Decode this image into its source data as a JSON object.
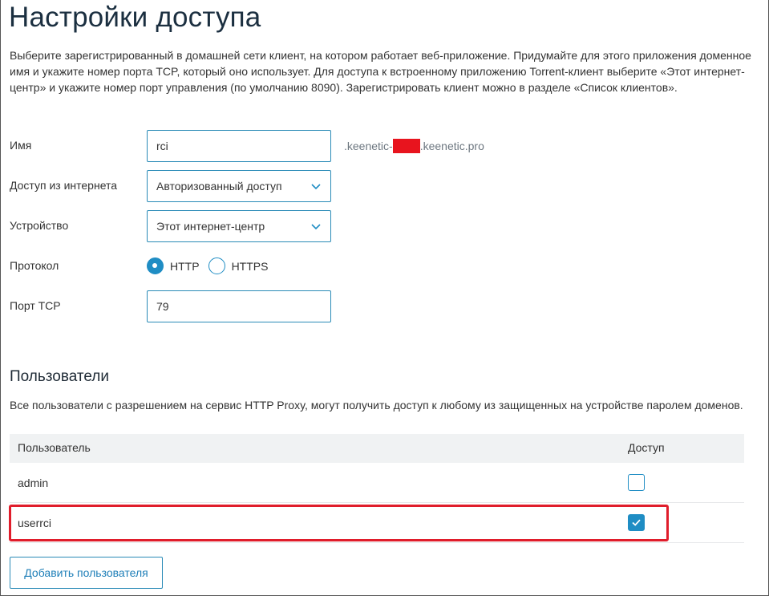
{
  "page": {
    "title": "Настройки доступа",
    "description": "Выберите зарегистрированный в домашней сети клиент, на котором работает веб-приложение. Придумайте для этого приложения доменное имя и укажите номер порта TCP, который оно использует. Для доступа к встроенному приложению Torrent-клиент выберите «Этот интернет-центр» и укажите номер порт управления (по умолчанию 8090). Зарегистрировать клиент можно в разделе «Список клиентов»."
  },
  "form": {
    "name_label": "Имя",
    "name_value": "rci",
    "domain_prefix": ".keenetic-",
    "domain_suffix": ".keenetic.pro",
    "access_label": "Доступ из интернета",
    "access_value": "Авторизованный доступ",
    "device_label": "Устройство",
    "device_value": "Этот интернет-центр",
    "protocol_label": "Протокол",
    "protocol_options": [
      "HTTP",
      "HTTPS"
    ],
    "protocol_selected": "HTTP",
    "port_label": "Порт TCP",
    "port_value": "79"
  },
  "users": {
    "title": "Пользователи",
    "description": "Все пользователи с разрешением на сервис HTTP Proxy, могут получить доступ к любому из защищенных на устройстве паролем доменов.",
    "col_user": "Пользователь",
    "col_access": "Доступ",
    "rows": [
      {
        "name": "admin",
        "access": false
      },
      {
        "name": "userrci",
        "access": true
      }
    ],
    "add_button": "Добавить пользователя"
  },
  "colors": {
    "accent": "#1f8dc4",
    "highlight": "#e01d2b",
    "redaction": "#e8141e",
    "title": "#1b2f40"
  },
  "icons": [
    "chevron-down-icon",
    "checkmark-icon"
  ]
}
